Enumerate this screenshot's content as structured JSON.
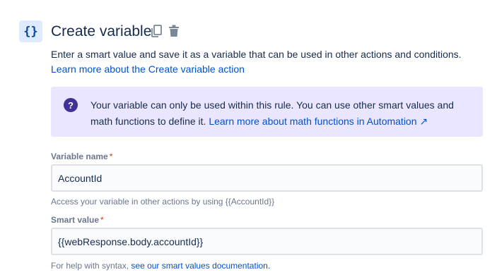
{
  "header": {
    "icon_glyph": "{}",
    "title": "Create variable",
    "copy_icon": "copy-icon",
    "delete_icon": "trash-icon"
  },
  "description": {
    "text": "Enter a smart value and save it as a variable that can be used in other actions and conditions. ",
    "link_text": "Learn more about the Create variable action"
  },
  "info": {
    "icon_glyph": "?",
    "text": "Your variable can only be used within this rule. You can use other smart values and math functions to define it. ",
    "link_text": "Learn more about math functions in Automation ↗"
  },
  "variable_name": {
    "label": "Variable name",
    "required_mark": "*",
    "value": "AccountId",
    "helper": "Access your variable in other actions by using {{AccountId}}"
  },
  "smart_value": {
    "label": "Smart value",
    "required_mark": "*",
    "value": "{{webResponse.body.accountId}}",
    "helper_prefix": "For help with syntax, ",
    "helper_link": "see our smart values documentation."
  },
  "colors": {
    "accent": "#0052cc",
    "info_background": "#eae6ff",
    "info_icon": "#403294",
    "required": "#de350b"
  }
}
